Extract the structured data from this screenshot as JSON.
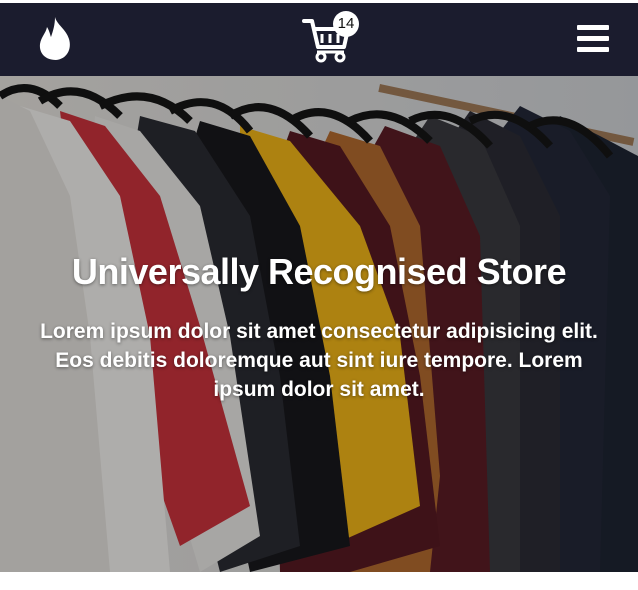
{
  "navbar": {
    "logo_icon": "flame-icon",
    "cart_icon": "shopping-cart-icon",
    "cart_count": "14",
    "menu_icon": "hamburger-menu-icon",
    "background": "#1b1c2e"
  },
  "hero": {
    "title": "Universally Recognised Store",
    "text": "Lorem ipsum dolor sit amet consectetur adipisicing elit. Eos debitis doloremque aut sint iure tempore. Lorem ipsum dolor sit amet.",
    "background_image": "clothing-rack-photo"
  }
}
